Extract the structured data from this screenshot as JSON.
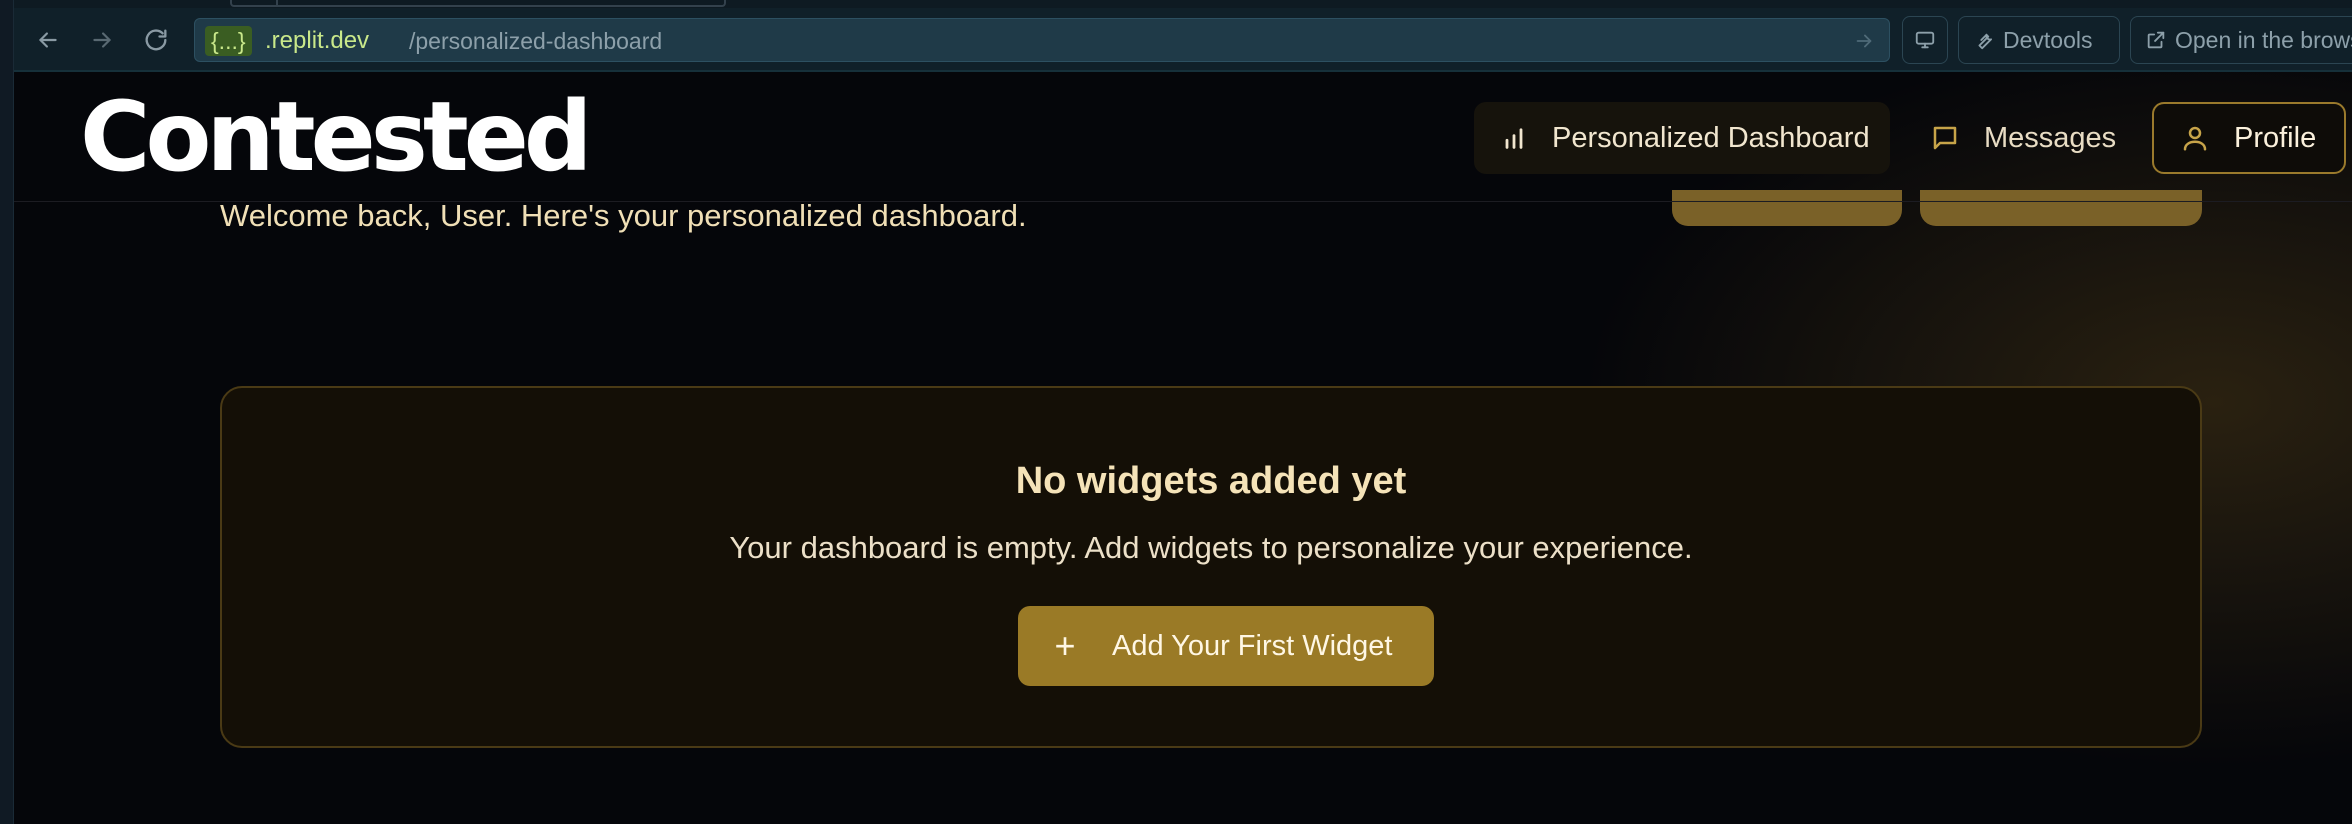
{
  "browser": {
    "url_host_tag": "{...}",
    "url_host": ".replit.dev",
    "url_path": "/personalized-dashboard",
    "devtools_label": "Devtools",
    "open_label": "Open in the brows"
  },
  "app": {
    "logo": "Contested",
    "nav": {
      "dashboard": "Personalized Dashboard",
      "messages": "Messages",
      "profile": "Profile"
    },
    "welcome": "Welcome back, User. Here's your personalized dashboard.",
    "empty_state": {
      "title": "No widgets added yet",
      "description": "Your dashboard is empty. Add widgets to personalize your experience.",
      "button": "Add Your First Widget"
    }
  },
  "colors": {
    "accent": "#9a7a26",
    "background": "#05060a",
    "card": "#140f06"
  },
  "icons": [
    "back-arrow-icon",
    "forward-arrow-icon",
    "reload-icon",
    "go-arrow-icon",
    "display-icon",
    "wrench-icon",
    "external-link-icon",
    "bar-chart-icon",
    "message-icon",
    "user-icon",
    "plus-icon"
  ]
}
